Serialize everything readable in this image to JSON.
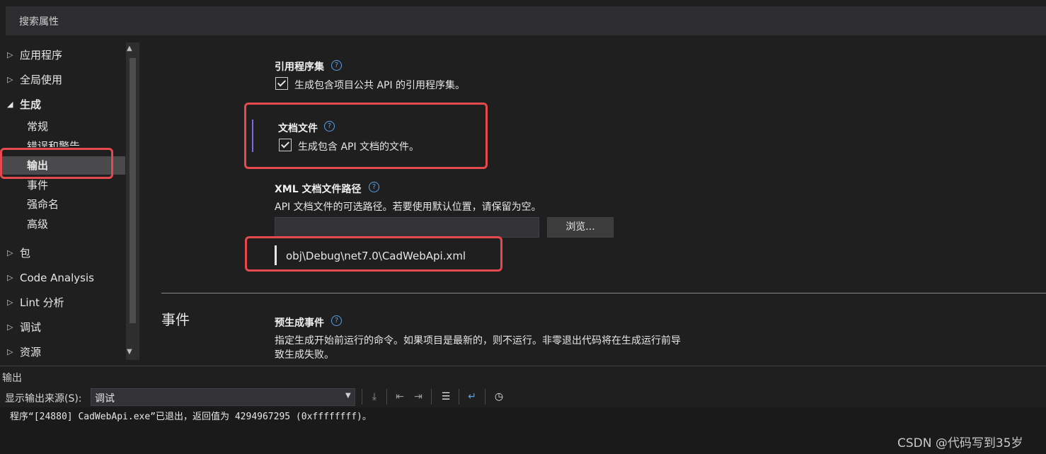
{
  "search": {
    "placeholder": "搜索属性"
  },
  "sidebar": {
    "items": [
      {
        "label": "应用程序"
      },
      {
        "label": "全局使用"
      },
      {
        "label": "生成"
      },
      {
        "label": "包"
      },
      {
        "label": "Code Analysis"
      },
      {
        "label": "Lint 分析"
      },
      {
        "label": "调试"
      },
      {
        "label": "资源"
      }
    ],
    "sub_items": [
      "常规",
      "错误和警告",
      "输出",
      "事件",
      "强命名",
      "高级"
    ]
  },
  "main": {
    "ref_assembly": {
      "title": "引用程序集",
      "checkbox_label": "生成包含项目公共 API 的引用程序集。",
      "checked": true
    },
    "doc_file": {
      "title": "文档文件",
      "checkbox_label": "生成包含 API 文档的文件。",
      "checked": true
    },
    "xml_path": {
      "title": "XML 文档文件路径",
      "desc": "API 文档文件的可选路径。若要使用默认位置，请保留为空。",
      "browse_label": "浏览...",
      "hint_value": "obj\\Debug\\net7.0\\CadWebApi.xml"
    },
    "events": {
      "section_title": "事件",
      "prebuild_title": "预生成事件",
      "prebuild_desc_1": "指定生成开始前运行的命令。如果项目是最新的，则不运行。非零退出代码将在生成运行前导",
      "prebuild_desc_2": "致生成失败。"
    }
  },
  "output": {
    "title": "输出",
    "source_label": "显示输出来源(S):",
    "source_value": "调试",
    "line": "程序“[24880] CadWebApi.exe”已退出，返回值为 4294967295 (0xffffffff)。"
  },
  "watermark": "CSDN @代码写到35岁",
  "colors": {
    "accent_red": "#e5484d",
    "help_blue": "#5aa0e6",
    "focus_purple": "#7b68ee"
  }
}
